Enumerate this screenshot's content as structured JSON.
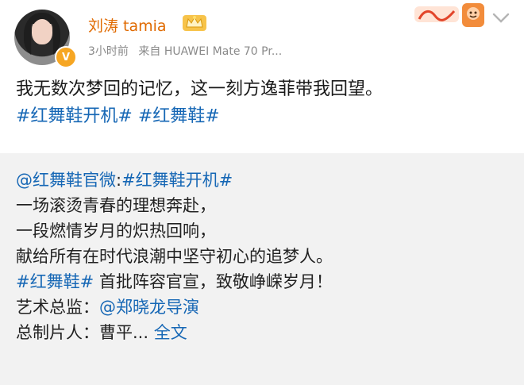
{
  "author": {
    "name": "刘涛 tamia",
    "verified_mark": "V"
  },
  "meta": {
    "time": "3小时前",
    "source": "来自 HUAWEI Mate 70 Pr..."
  },
  "post": {
    "text": "我无数次梦回的记忆，这一刻方逸菲带我回望。",
    "topics": [
      "#红舞鞋开机#",
      "#红舞鞋#"
    ]
  },
  "repost": {
    "mention": "@红舞鞋官微",
    "colon": ":",
    "topic": "#红舞鞋开机#",
    "lines": [
      "一场滚烫青春的理想奔赴，",
      "一段燃情岁月的炽热回响，",
      "献给所有在时代浪潮中坚守初心的追梦人。"
    ],
    "announce_topic": "#红舞鞋#",
    "announce_text": " 首批阵容官宣，致敬峥嵘岁月！",
    "art_director_label": "艺术总监：",
    "art_director": "@郑晓龙导演",
    "producer_label": "总制片人：",
    "producer": "曹平...",
    "full_text_link": "全文"
  },
  "colors": {
    "username": "#e06a00",
    "link": "#1667b5",
    "repost_bg": "#f2f2f2"
  },
  "icons": [
    "verified-icon",
    "crown-badge-icon",
    "sticker-icon",
    "chevron-down-icon"
  ]
}
